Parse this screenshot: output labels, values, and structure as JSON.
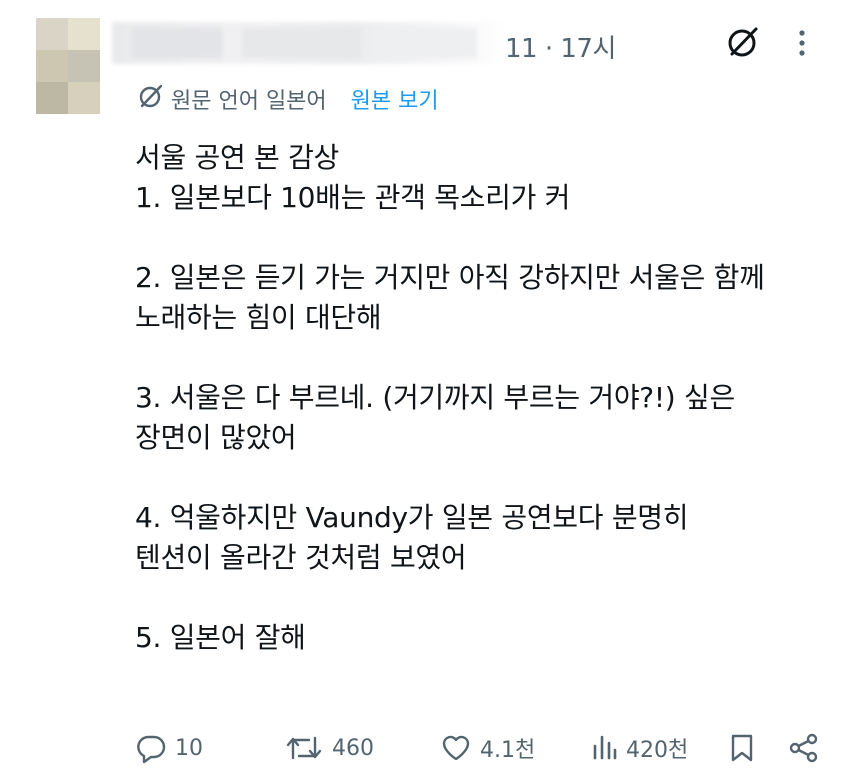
{
  "header": {
    "timestamp": "11 · 17시",
    "avatar_colors": [
      "#d9d4c5",
      "#e6e0cf",
      "#cdc7b2",
      "#c7c3b4",
      "#bdb8a4",
      "#d6d0bd"
    ]
  },
  "translation": {
    "label": "원문 언어 일본어",
    "show_original": "원본 보기"
  },
  "tweet": {
    "lines": [
      "서울 공연 본 감상",
      "1. 일본보다 10배는 관객 목소리가 커",
      "",
      "2. 일본은 듣기 가는 거지만 아직 강하지만 서울은 함께",
      "노래하는 힘이 대단해",
      "",
      "3. 서울은 다 부르네. (거기까지 부르는 거야?!) 싶은",
      "장면이 많았어",
      "",
      "4. 억울하지만 Vaundy가 일본 공연보다 분명히",
      "텐션이 올라간 것처럼 보였어",
      "",
      "5. 일본어 잘해"
    ]
  },
  "actions": {
    "replies": "10",
    "retweets": "460",
    "likes": "4.1천",
    "views": "420천"
  },
  "colors": {
    "text": "#0f1419",
    "muted": "#536471",
    "accent": "#1d9bf0"
  },
  "icons": [
    "grok-icon",
    "more-icon",
    "translate-icon",
    "reply-icon",
    "retweet-icon",
    "like-icon",
    "views-icon",
    "bookmark-icon",
    "share-icon"
  ]
}
